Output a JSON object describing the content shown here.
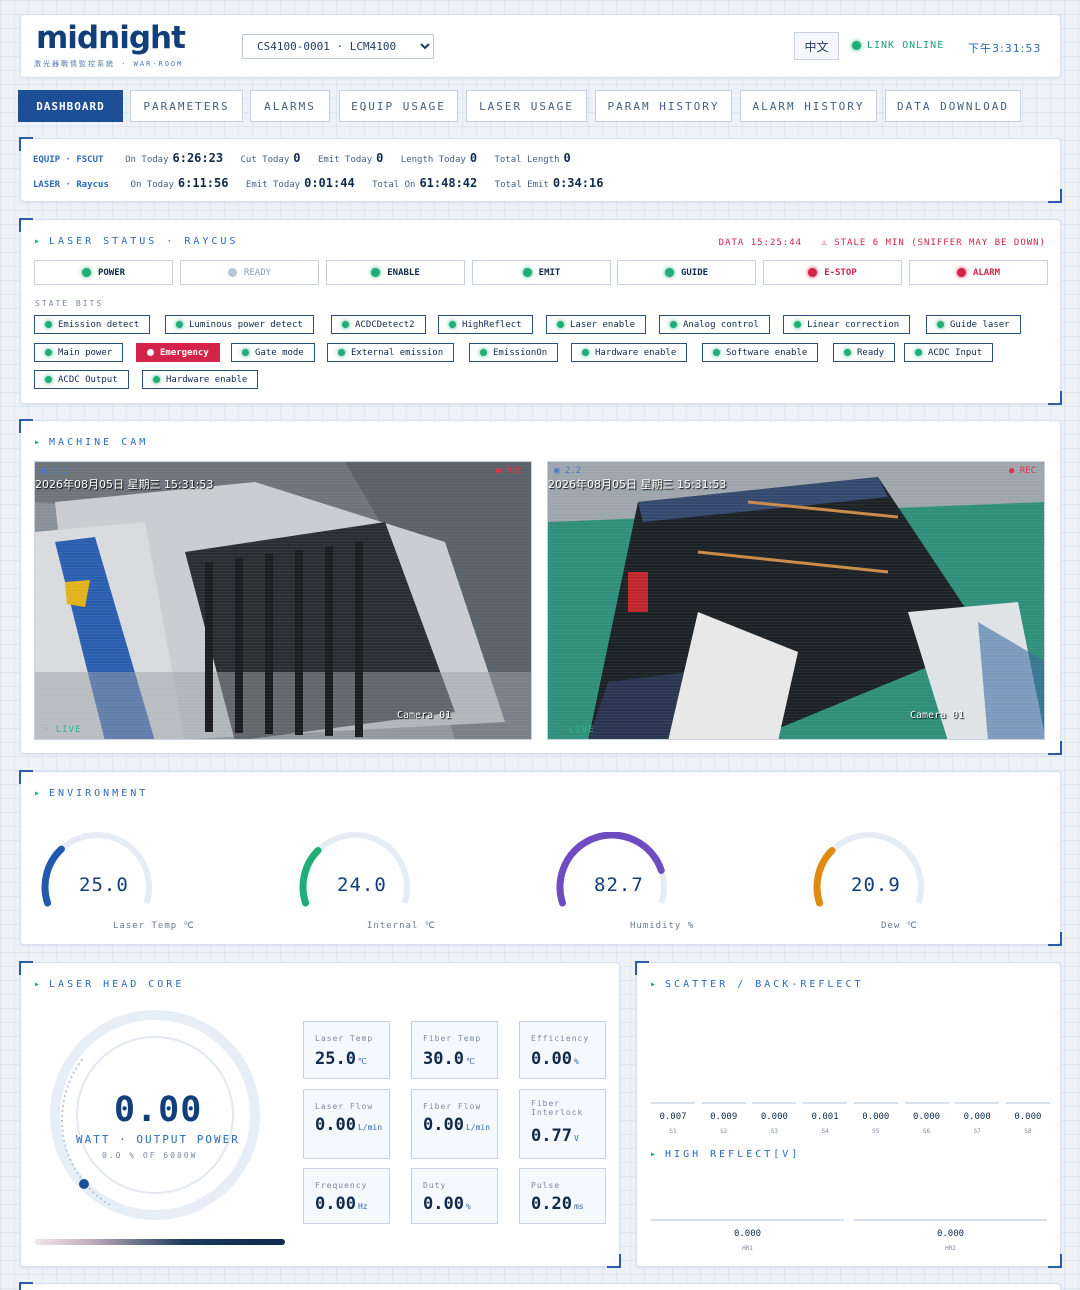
{
  "header": {
    "logo": "midnight",
    "subtitle": "激光器戰情監控系統 · WAR-ROOM",
    "device": "CS4100-0001 · LCM4100",
    "lang": "中文",
    "link_status": "LINK ONLINE",
    "clock": "下午3:31:53"
  },
  "tabs": [
    "DASHBOARD",
    "PARAMETERS",
    "ALARMS",
    "EQUIP USAGE",
    "LASER USAGE",
    "PARAM HISTORY",
    "ALARM HISTORY",
    "DATA DOWNLOAD"
  ],
  "equip": {
    "tag": "EQUIP · FSCUT",
    "on_today_label": "On Today",
    "on_today": "6:26:23",
    "cut_today_label": "Cut Today",
    "cut_today": "0",
    "emit_today_label": "Emit Today",
    "emit_today": "0",
    "length_today_label": "Length Today",
    "length_today": "0",
    "total_length_label": "Total Length",
    "total_length": "0"
  },
  "laser": {
    "tag": "LASER · Raycus",
    "on_today_label": "On Today",
    "on_today": "6:11:56",
    "emit_today_label": "Emit Today",
    "emit_today": "0:01:44",
    "total_on_label": "Total On",
    "total_on": "61:48:42",
    "total_emit_label": "Total Emit",
    "total_emit": "0:34:16"
  },
  "laser_status": {
    "title": "LASER STATUS · RAYCUS",
    "data_time": "DATA 15:25:44",
    "stale": "STALE 6 MIN (SNIFFER MAY BE DOWN)",
    "pills": [
      {
        "label": "POWER",
        "state": "green"
      },
      {
        "label": "READY",
        "state": "grey"
      },
      {
        "label": "ENABLE",
        "state": "green"
      },
      {
        "label": "EMIT",
        "state": "green"
      },
      {
        "label": "GUIDE",
        "state": "green"
      },
      {
        "label": "E-STOP",
        "state": "red"
      },
      {
        "label": "ALARM",
        "state": "red"
      }
    ],
    "bits_title": "STATE BITS",
    "bits": [
      "Emission detect",
      "Luminous power detect",
      "ACDCDetect2",
      "HighReflect",
      "Laser enable",
      "Analog control",
      "Linear correction",
      "Guide laser",
      "Main power",
      "Emergency",
      "Gate mode",
      "External emission",
      "EmissionOn",
      "Hardware enable",
      "Software enable",
      "Ready",
      "ACDC Input",
      "ACDC Output",
      "Hardware enable"
    ],
    "alarm_bit": "Emergency"
  },
  "machine_cam": {
    "title": "MACHINE CAM",
    "cams": [
      {
        "id": "▣ 2.1",
        "timestamp": "2026年08月05日 星期三 15:31:53",
        "rec": "● REC",
        "name": "Camera 01",
        "live": "◦ LIVE"
      },
      {
        "id": "▣ 2.2",
        "timestamp": "2026年08月05日 星期三 15:31:53",
        "rec": "● REC",
        "name": "Camera 01",
        "live": "◦ LIVE"
      }
    ]
  },
  "environment": {
    "title": "ENVIRONMENT",
    "gauges": [
      {
        "value": "25.0",
        "label": "Laser Temp ℃",
        "fraction": 0.3,
        "color": "#2259b0"
      },
      {
        "value": "24.0",
        "label": "Internal ℃",
        "fraction": 0.29,
        "color": "#1fae78"
      },
      {
        "value": "82.7",
        "label": "Humidity %",
        "fraction": 0.83,
        "color": "#6d4cc2"
      },
      {
        "value": "20.9",
        "label": "Dew ℃",
        "fraction": 0.29,
        "color": "#e08a12"
      }
    ]
  },
  "laser_head": {
    "title": "LASER HEAD CORE",
    "power": "0.00",
    "power_label": "WATT · OUTPUT POWER",
    "power_sub": "0.0 % OF 6000W",
    "metrics": [
      {
        "label": "Laser Temp",
        "value": "25.0",
        "unit": "℃"
      },
      {
        "label": "Fiber Temp",
        "value": "30.0",
        "unit": "℃"
      },
      {
        "label": "Efficiency",
        "value": "0.00",
        "unit": "%"
      },
      {
        "label": "Laser Flow",
        "value": "0.00",
        "unit": "L/min"
      },
      {
        "label": "Fiber Flow",
        "value": "0.00",
        "unit": "L/min"
      },
      {
        "label": "Fiber Interlock",
        "value": "0.77",
        "unit": "V"
      },
      {
        "label": "Frequency",
        "value": "0.00",
        "unit": "Hz"
      },
      {
        "label": "Duty",
        "value": "0.00",
        "unit": "%"
      },
      {
        "label": "Pulse",
        "value": "0.20",
        "unit": "ms"
      }
    ]
  },
  "scatter": {
    "title": "SCATTER / BACK-REFLECT",
    "items": [
      {
        "name": "S1",
        "value": "0.007"
      },
      {
        "name": "S2",
        "value": "0.009"
      },
      {
        "name": "S3",
        "value": "0.000"
      },
      {
        "name": "S4",
        "value": "0.001"
      },
      {
        "name": "S5",
        "value": "0.000"
      },
      {
        "name": "S6",
        "value": "0.000"
      },
      {
        "name": "S7",
        "value": "0.000"
      },
      {
        "name": "S8",
        "value": "0.000"
      }
    ],
    "hr_title": "HIGH REFLECT[V]",
    "hr": [
      {
        "name": "HR1",
        "value": "0.000"
      },
      {
        "name": "HR2",
        "value": "0.000"
      }
    ]
  },
  "colors": {
    "accent": "#1d4f96",
    "ok": "#1fae78",
    "alarm": "#d4234a"
  }
}
